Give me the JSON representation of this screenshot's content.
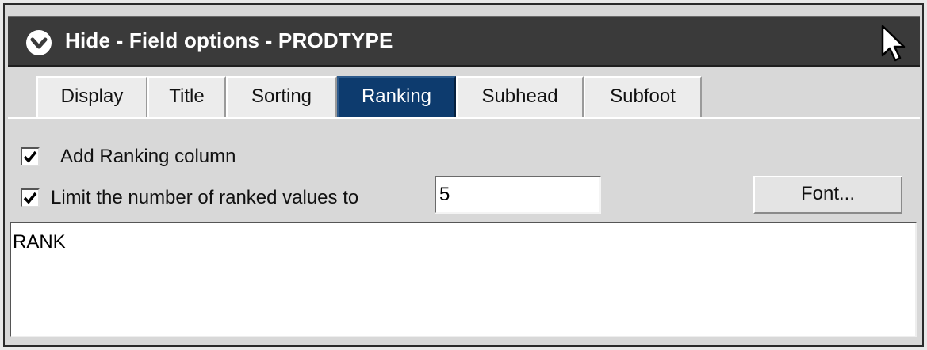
{
  "window": {
    "title": "Hide - Field options - PRODTYPE",
    "collapse_icon": "chevron-down-circle-icon",
    "cursor_icon": "mouse-pointer-icon"
  },
  "tabs": [
    {
      "label": "Display",
      "active": false
    },
    {
      "label": "Title",
      "active": false
    },
    {
      "label": "Sorting",
      "active": false
    },
    {
      "label": "Ranking",
      "active": true
    },
    {
      "label": "Subhead",
      "active": false
    },
    {
      "label": "Subfoot",
      "active": false
    }
  ],
  "ranking": {
    "add_ranking_column": {
      "label": "Add Ranking column",
      "checked": true
    },
    "limit_values": {
      "label": "Limit the number of ranked values to",
      "checked": true
    },
    "limit_value": "5",
    "font_button_label": "Font...",
    "column_title_text": "RANK"
  },
  "colors": {
    "title_bar": "#3a3a3a",
    "active_tab": "#0d3b6e",
    "panel_background": "#d8d8d8"
  }
}
